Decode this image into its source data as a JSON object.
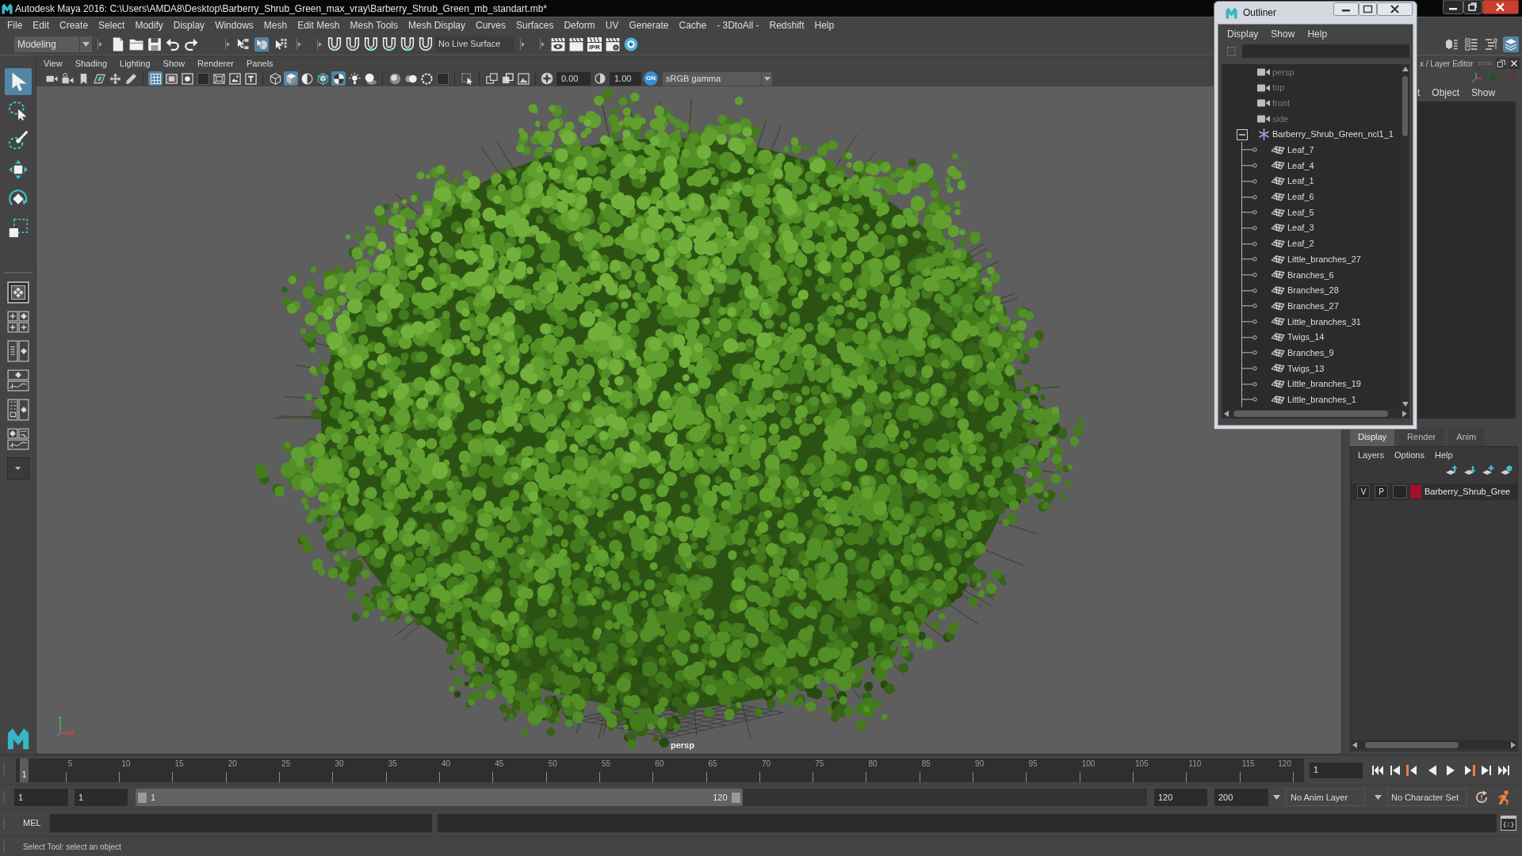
{
  "window": {
    "title": "Autodesk Maya 2016: C:\\Users\\AMDA8\\Desktop\\Barberry_Shrub_Green_max_vray\\Barberry_Shrub_Green_mb_standart.mb*"
  },
  "menu_bar": [
    "File",
    "Edit",
    "Create",
    "Select",
    "Modify",
    "Display",
    "Windows",
    "Mesh",
    "Edit Mesh",
    "Mesh Tools",
    "Mesh Display",
    "Curves",
    "Surfaces",
    "Deform",
    "UV",
    "Generate",
    "Cache",
    "- 3DtoAll -",
    "Redshift",
    "Help"
  ],
  "status_line": {
    "workspace": "Modeling",
    "selection_modes": [
      {
        "selected": false
      },
      {
        "selected": true
      },
      {
        "selected": false
      }
    ],
    "live_surface": "No Live Surface",
    "ipr_label": "IPR",
    "panel_toggles": [
      {
        "on": false
      },
      {
        "on": false
      },
      {
        "on": false
      },
      {
        "on": true
      }
    ]
  },
  "toolbox": {
    "tools": [
      {
        "selected": true
      },
      {
        "selected": false
      },
      {
        "selected": false
      },
      {
        "selected": false
      },
      {
        "selected": false
      },
      {
        "selected": false
      }
    ]
  },
  "viewport": {
    "menu": [
      "View",
      "Shading",
      "Lighting",
      "Show",
      "Renderer",
      "Panels"
    ],
    "toggles": [
      {
        "on": false
      },
      {
        "on": false
      },
      {
        "on": false
      },
      {
        "on": false
      },
      {
        "on": false
      },
      {
        "on": false
      },
      {
        "on": true
      },
      {
        "on": false
      },
      {
        "on": false
      },
      {
        "on": false
      },
      {
        "on": false
      },
      {
        "on": false
      },
      {
        "on": false
      },
      {
        "on": false
      },
      {
        "on": true
      },
      {
        "on": false
      },
      {
        "on": false
      },
      {
        "on": true
      },
      {
        "on": false
      },
      {
        "on": false
      },
      {
        "on": false
      },
      {
        "on": false
      },
      {
        "on": false
      },
      {
        "on": false
      },
      {
        "on": false
      },
      {
        "on": false
      },
      {
        "on": false
      },
      {
        "on": false
      }
    ],
    "exposure": "0.00",
    "gamma": "1.00",
    "color_management": {
      "label": "ON",
      "on": true
    },
    "color_space": "sRGB gamma",
    "camera_label": "persp"
  },
  "outliner": {
    "title": "Outliner",
    "menu": [
      "Display",
      "Show",
      "Help"
    ],
    "items": [
      {
        "label": "persp",
        "kind": "camera",
        "dimmed": true,
        "expanded": false
      },
      {
        "label": "top",
        "kind": "camera",
        "dimmed": true,
        "expanded": false
      },
      {
        "label": "front",
        "kind": "camera",
        "dimmed": true,
        "expanded": false
      },
      {
        "label": "side",
        "kind": "camera",
        "dimmed": true,
        "expanded": false
      },
      {
        "label": "Barberry_Shrub_Green_ncl1_1",
        "kind": "group",
        "dimmed": false,
        "expanded": true,
        "children": [
          {
            "label": "Leaf_7",
            "kind": "mesh",
            "dimmed": false
          },
          {
            "label": "Leaf_4",
            "kind": "mesh",
            "dimmed": false
          },
          {
            "label": "Leaf_1",
            "kind": "mesh",
            "dimmed": false
          },
          {
            "label": "Leaf_6",
            "kind": "mesh",
            "dimmed": false
          },
          {
            "label": "Leaf_5",
            "kind": "mesh",
            "dimmed": false
          },
          {
            "label": "Leaf_3",
            "kind": "mesh",
            "dimmed": false
          },
          {
            "label": "Leaf_2",
            "kind": "mesh",
            "dimmed": false
          },
          {
            "label": "Little_branches_27",
            "kind": "mesh",
            "dimmed": false
          },
          {
            "label": "Branches_6",
            "kind": "mesh",
            "dimmed": false
          },
          {
            "label": "Branches_28",
            "kind": "mesh",
            "dimmed": false
          },
          {
            "label": "Branches_27",
            "kind": "mesh",
            "dimmed": false
          },
          {
            "label": "Little_branches_31",
            "kind": "mesh",
            "dimmed": false
          },
          {
            "label": "Twigs_14",
            "kind": "mesh",
            "dimmed": false
          },
          {
            "label": "Branches_9",
            "kind": "mesh",
            "dimmed": false
          },
          {
            "label": "Twigs_13",
            "kind": "mesh",
            "dimmed": false
          },
          {
            "label": "Little_branches_19",
            "kind": "mesh",
            "dimmed": false
          },
          {
            "label": "Little_branches_1",
            "kind": "mesh",
            "dimmed": false
          }
        ]
      }
    ]
  },
  "channel_box": {
    "title": "x / Layer Editor",
    "menu": [
      "t",
      "Object",
      "Show"
    ]
  },
  "layer_editor": {
    "tabs": [
      {
        "label": "Display",
        "selected": true
      },
      {
        "label": "Render",
        "selected": false
      },
      {
        "label": "Anim",
        "selected": false
      }
    ],
    "menu": [
      "Layers",
      "Options",
      "Help"
    ],
    "layers": [
      {
        "visibility": "V",
        "playback": "P",
        "color": "#a3102c",
        "name": "Barberry_Shrub_Gree"
      }
    ]
  },
  "time_slider": {
    "ticks": [
      "5",
      "10",
      "15",
      "20",
      "25",
      "30",
      "35",
      "40",
      "45",
      "50",
      "55",
      "60",
      "65",
      "70",
      "75",
      "80",
      "85",
      "90",
      "95",
      "100",
      "105",
      "110",
      "115",
      "120"
    ],
    "current_frame": "1",
    "level": 0,
    "frame_field": "1"
  },
  "range_slider": {
    "start_field": "1",
    "playback_start_field": "1",
    "handle_start": "1",
    "handle_end": "120",
    "level": 0.6,
    "playback_end_field": "120",
    "end_field": "200",
    "anim_layer": "No Anim Layer",
    "character_set": "No Character Set"
  },
  "command_line": {
    "language": "MEL",
    "script_editor_label": "{;}"
  },
  "help_line": "Select Tool: select an object"
}
